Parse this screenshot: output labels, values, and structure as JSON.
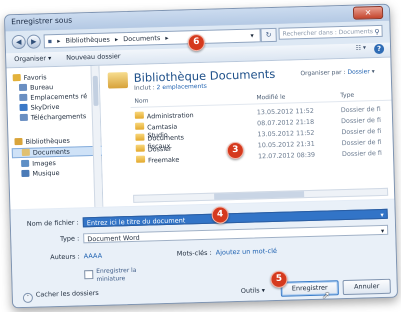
{
  "window": {
    "title": "Enregistrer sous",
    "close_icon": "close-icon"
  },
  "address": {
    "segments": [
      "Bibliothèques",
      "Documents"
    ],
    "search_placeholder": "Rechercher dans : Documents"
  },
  "toolbar": {
    "organize": "Organiser",
    "new_folder": "Nouveau dossier"
  },
  "nav": {
    "items": [
      {
        "label": "Favoris",
        "color": "#e3b23c"
      },
      {
        "label": "Bureau",
        "color": "#6a8fc2"
      },
      {
        "label": "Emplacements ré",
        "color": "#6a8fc2"
      },
      {
        "label": "SkyDrive",
        "color": "#3a78c7"
      },
      {
        "label": "Téléchargements",
        "color": "#6a8fc2"
      },
      {
        "label": "Bibliothèques",
        "color": "#d9a43a"
      },
      {
        "label": "Documents",
        "color": "#e0c070"
      },
      {
        "label": "Images",
        "color": "#5f8fc5"
      },
      {
        "label": "Musique",
        "color": "#4b7bb7"
      }
    ]
  },
  "library": {
    "title": "Bibliothèque Documents",
    "includes_prefix": "Inclut :",
    "includes_link": "2 emplacements",
    "arrange_label": "Organiser par :",
    "arrange_value": "Dossier"
  },
  "columns": {
    "name": "Nom",
    "modified": "Modifié le",
    "type": "Type"
  },
  "files": [
    {
      "name": "Administration",
      "date": "13.05.2012 11:52",
      "type": "Dossier de fi"
    },
    {
      "name": "Camtasia Studio",
      "date": "08.07.2012 21:18",
      "type": "Dossier de fi"
    },
    {
      "name": "Documents fiscaux",
      "date": "13.05.2012 11:52",
      "type": "Dossier de fi"
    },
    {
      "name": "Dossier",
      "date": "10.05.2012 21:31",
      "type": "Dossier de fi"
    },
    {
      "name": "Freemake",
      "date": "12.07.2012 08:39",
      "type": "Dossier de fi"
    }
  ],
  "form": {
    "filename_label": "Nom de fichier :",
    "filename_value": "Entrez ici le titre du document",
    "type_label": "Type :",
    "type_value": "Document Word",
    "authors_label": "Auteurs :",
    "authors_value": "AAAA",
    "tags_label": "Mots-clés :",
    "tags_value": "Ajoutez un mot-clé",
    "thumb_label_1": "Enregistrer la",
    "thumb_label_2": "miniature"
  },
  "footer": {
    "hide_folders": "Cacher les dossiers",
    "tools": "Outils",
    "save": "Enregistrer",
    "cancel": "Annuler"
  },
  "badges": [
    "6",
    "3",
    "4",
    "5"
  ],
  "colors": {
    "accent": "#3274c7",
    "badge": "#d53a1e",
    "library_title": "#1d4f89"
  }
}
